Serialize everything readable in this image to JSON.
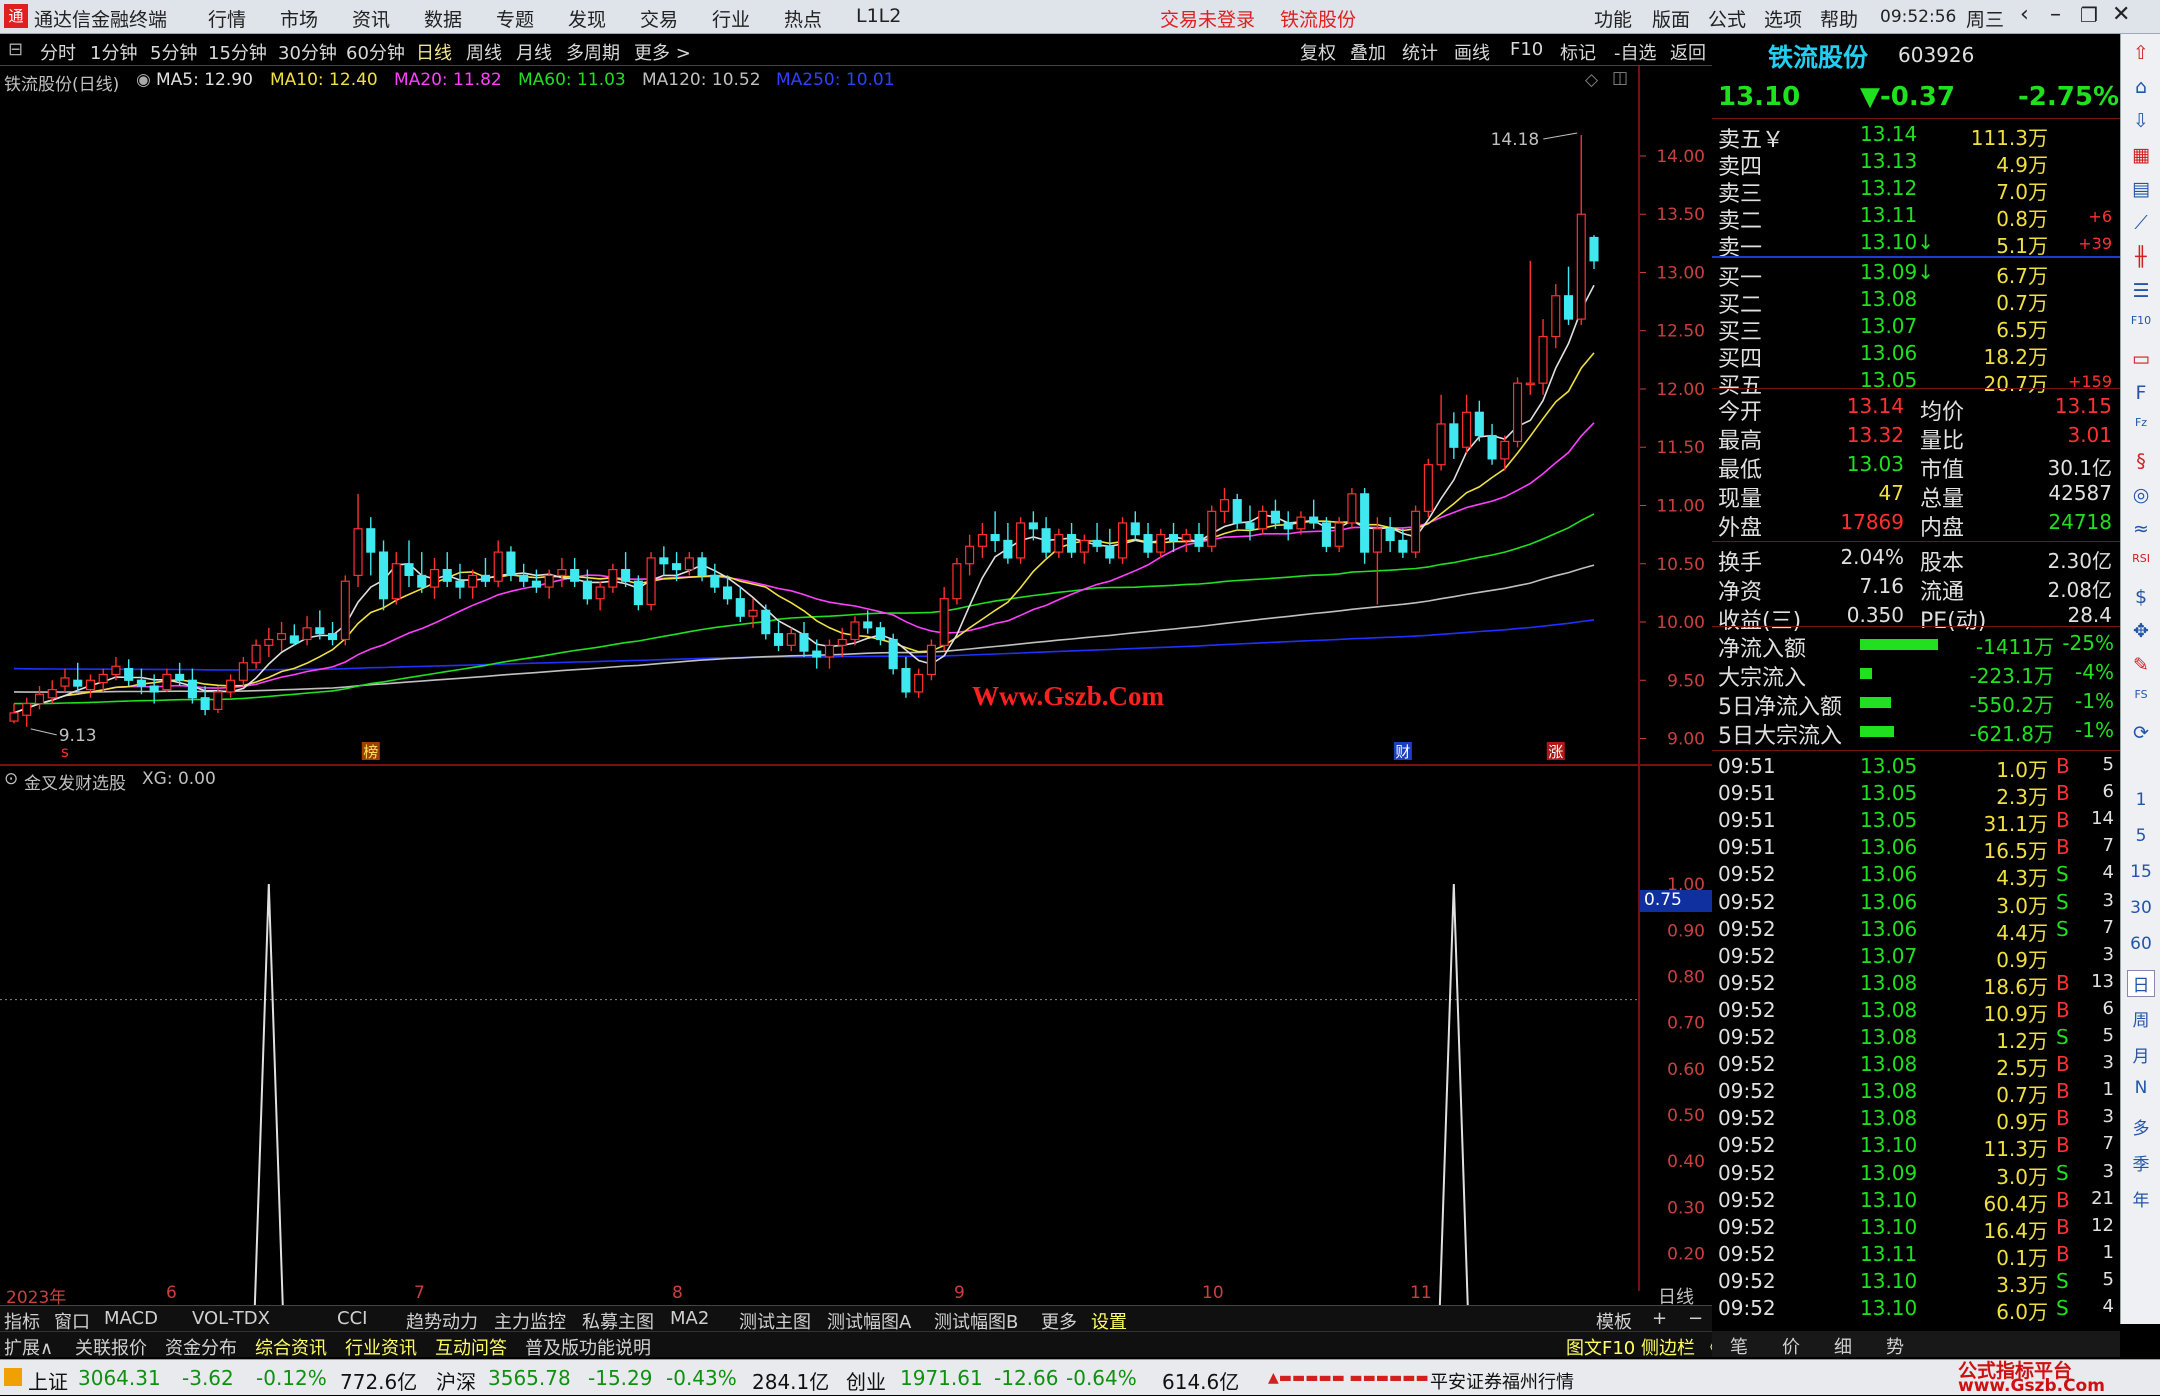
{
  "titlebar": {
    "app_title": "通达信金融终端",
    "menus": [
      "行情",
      "市场",
      "资讯",
      "数据",
      "专题",
      "发现",
      "交易",
      "行业",
      "热点",
      "L1L2"
    ],
    "status": "交易未登录",
    "stock": "铁流股份",
    "right_menus": [
      "功能",
      "版面",
      "公式",
      "选项",
      "帮助"
    ],
    "clock": "09:52:56",
    "weekday": "周三"
  },
  "toolbar": {
    "periods": [
      "分时",
      "1分钟",
      "5分钟",
      "15分钟",
      "30分钟",
      "60分钟",
      "日线",
      "周线",
      "月线",
      "多周期",
      "更多 >"
    ],
    "selected": "日线",
    "right": [
      "复权",
      "叠加",
      "统计",
      "画线",
      "F10",
      "标记",
      "-自选",
      "返回"
    ]
  },
  "chart_header": {
    "name": "铁流股份(日线)",
    "ma": [
      {
        "label": "MA5: 12.90",
        "color": "#e0e0e0"
      },
      {
        "label": "MA10: 12.40",
        "color": "#f0e040"
      },
      {
        "label": "MA20: 11.82",
        "color": "#ff40ff"
      },
      {
        "label": "MA60: 11.03",
        "color": "#20e020"
      },
      {
        "label": "MA120: 10.52",
        "color": "#c0c0c0"
      },
      {
        "label": "MA250: 10.01",
        "color": "#3040ff"
      }
    ]
  },
  "watermark": "Www.Gszb.Com",
  "high_label": "14.18",
  "low_label": "9.13",
  "markers": {
    "s": "s",
    "bang": "榜",
    "cai": "财",
    "zhang": "涨"
  },
  "indicator": {
    "name": "金叉发财选股",
    "value": "XG: 0.00",
    "cursor_value": "0.75"
  },
  "dates": {
    "start": "2023年",
    "m6": "6",
    "m7": "7",
    "m8": "8",
    "m9": "9",
    "m10": "10",
    "m11": "11",
    "period": "日线"
  },
  "chart_data": [
    {
      "type": "candlestick",
      "title": "铁流股份(日线)",
      "ylim": [
        8.85,
        14.3
      ],
      "yticks": [
        9.0,
        9.5,
        10.0,
        10.5,
        11.0,
        11.5,
        12.0,
        12.5,
        13.0,
        13.5,
        14.0
      ],
      "annotations": [
        "14.18",
        "9.13"
      ],
      "ohlc": [
        [
          9.15,
          9.3,
          9.13,
          9.22
        ],
        [
          9.2,
          9.35,
          9.1,
          9.3
        ],
        [
          9.3,
          9.45,
          9.25,
          9.38
        ],
        [
          9.35,
          9.5,
          9.3,
          9.42
        ],
        [
          9.45,
          9.6,
          9.4,
          9.52
        ],
        [
          9.5,
          9.65,
          9.4,
          9.45
        ],
        [
          9.42,
          9.55,
          9.35,
          9.5
        ],
        [
          9.48,
          9.6,
          9.4,
          9.55
        ],
        [
          9.55,
          9.7,
          9.5,
          9.62
        ],
        [
          9.6,
          9.68,
          9.45,
          9.5
        ],
        [
          9.5,
          9.6,
          9.38,
          9.45
        ],
        [
          9.45,
          9.55,
          9.3,
          9.4
        ],
        [
          9.42,
          9.6,
          9.4,
          9.55
        ],
        [
          9.55,
          9.65,
          9.45,
          9.5
        ],
        [
          9.5,
          9.6,
          9.3,
          9.35
        ],
        [
          9.35,
          9.45,
          9.2,
          9.25
        ],
        [
          9.25,
          9.45,
          9.22,
          9.4
        ],
        [
          9.4,
          9.55,
          9.35,
          9.5
        ],
        [
          9.5,
          9.7,
          9.45,
          9.65
        ],
        [
          9.65,
          9.85,
          9.6,
          9.8
        ],
        [
          9.8,
          9.95,
          9.7,
          9.85
        ],
        [
          9.85,
          10.0,
          9.75,
          9.9
        ],
        [
          9.88,
          9.98,
          9.8,
          9.82
        ],
        [
          9.85,
          10.05,
          9.8,
          9.95
        ],
        [
          9.95,
          10.1,
          9.85,
          9.9
        ],
        [
          9.9,
          10.0,
          9.8,
          9.85
        ],
        [
          9.85,
          10.4,
          9.8,
          10.35
        ],
        [
          10.4,
          11.1,
          10.3,
          10.8
        ],
        [
          10.8,
          10.9,
          10.4,
          10.6
        ],
        [
          10.6,
          10.7,
          10.1,
          10.2
        ],
        [
          10.2,
          10.6,
          10.15,
          10.5
        ],
        [
          10.5,
          10.7,
          10.3,
          10.4
        ],
        [
          10.4,
          10.6,
          10.25,
          10.3
        ],
        [
          10.3,
          10.55,
          10.2,
          10.45
        ],
        [
          10.45,
          10.6,
          10.3,
          10.35
        ],
        [
          10.35,
          10.5,
          10.2,
          10.3
        ],
        [
          10.3,
          10.45,
          10.2,
          10.4
        ],
        [
          10.4,
          10.55,
          10.3,
          10.35
        ],
        [
          10.35,
          10.7,
          10.3,
          10.6
        ],
        [
          10.6,
          10.65,
          10.35,
          10.4
        ],
        [
          10.4,
          10.5,
          10.3,
          10.35
        ],
        [
          10.35,
          10.45,
          10.25,
          10.3
        ],
        [
          10.3,
          10.45,
          10.2,
          10.4
        ],
        [
          10.4,
          10.55,
          10.3,
          10.45
        ],
        [
          10.45,
          10.55,
          10.3,
          10.35
        ],
        [
          10.35,
          10.45,
          10.15,
          10.2
        ],
        [
          10.2,
          10.35,
          10.1,
          10.3
        ],
        [
          10.3,
          10.5,
          10.25,
          10.45
        ],
        [
          10.45,
          10.6,
          10.3,
          10.35
        ],
        [
          10.35,
          10.4,
          10.1,
          10.15
        ],
        [
          10.15,
          10.6,
          10.1,
          10.55
        ],
        [
          10.55,
          10.65,
          10.4,
          10.5
        ],
        [
          10.5,
          10.6,
          10.35,
          10.45
        ],
        [
          10.45,
          10.6,
          10.4,
          10.55
        ],
        [
          10.55,
          10.6,
          10.35,
          10.4
        ],
        [
          10.4,
          10.5,
          10.25,
          10.3
        ],
        [
          10.3,
          10.4,
          10.15,
          10.2
        ],
        [
          10.2,
          10.3,
          10.0,
          10.05
        ],
        [
          10.05,
          10.2,
          9.95,
          10.1
        ],
        [
          10.1,
          10.15,
          9.85,
          9.9
        ],
        [
          9.9,
          10.0,
          9.75,
          9.8
        ],
        [
          9.8,
          9.95,
          9.75,
          9.9
        ],
        [
          9.9,
          10.0,
          9.7,
          9.75
        ],
        [
          9.75,
          9.85,
          9.6,
          9.7
        ],
        [
          9.7,
          9.85,
          9.6,
          9.8
        ],
        [
          9.8,
          9.95,
          9.7,
          9.85
        ],
        [
          9.85,
          10.05,
          9.8,
          10.0
        ],
        [
          10.0,
          10.1,
          9.9,
          9.95
        ],
        [
          9.95,
          10.0,
          9.8,
          9.85
        ],
        [
          9.85,
          9.9,
          9.55,
          9.6
        ],
        [
          9.6,
          9.7,
          9.35,
          9.4
        ],
        [
          9.4,
          9.6,
          9.35,
          9.55
        ],
        [
          9.55,
          9.85,
          9.5,
          9.8
        ],
        [
          9.8,
          10.3,
          9.75,
          10.2
        ],
        [
          10.2,
          10.55,
          10.15,
          10.5
        ],
        [
          10.5,
          10.75,
          10.4,
          10.65
        ],
        [
          10.65,
          10.85,
          10.55,
          10.75
        ],
        [
          10.75,
          10.95,
          10.6,
          10.7
        ],
        [
          10.7,
          10.85,
          10.5,
          10.55
        ],
        [
          10.55,
          10.9,
          10.5,
          10.85
        ],
        [
          10.85,
          10.95,
          10.7,
          10.8
        ],
        [
          10.8,
          10.9,
          10.55,
          10.6
        ],
        [
          10.6,
          10.8,
          10.55,
          10.75
        ],
        [
          10.75,
          10.85,
          10.55,
          10.6
        ],
        [
          10.6,
          10.75,
          10.5,
          10.7
        ],
        [
          10.7,
          10.85,
          10.6,
          10.65
        ],
        [
          10.65,
          10.8,
          10.5,
          10.55
        ],
        [
          10.55,
          10.9,
          10.5,
          10.85
        ],
        [
          10.85,
          10.95,
          10.7,
          10.75
        ],
        [
          10.75,
          10.85,
          10.55,
          10.6
        ],
        [
          10.6,
          10.8,
          10.55,
          10.75
        ],
        [
          10.75,
          10.85,
          10.6,
          10.7
        ],
        [
          10.7,
          10.8,
          10.6,
          10.75
        ],
        [
          10.75,
          10.85,
          10.6,
          10.65
        ],
        [
          10.65,
          11.0,
          10.6,
          10.95
        ],
        [
          10.95,
          11.15,
          10.85,
          11.05
        ],
        [
          11.05,
          11.1,
          10.8,
          10.85
        ],
        [
          10.85,
          11.0,
          10.7,
          10.8
        ],
        [
          10.8,
          11.0,
          10.75,
          10.95
        ],
        [
          10.95,
          11.05,
          10.8,
          10.85
        ],
        [
          10.85,
          10.95,
          10.7,
          10.8
        ],
        [
          10.8,
          10.95,
          10.75,
          10.9
        ],
        [
          10.9,
          11.05,
          10.8,
          10.85
        ],
        [
          10.85,
          10.9,
          10.6,
          10.65
        ],
        [
          10.65,
          10.9,
          10.6,
          10.85
        ],
        [
          10.85,
          11.15,
          10.8,
          11.1
        ],
        [
          11.1,
          11.15,
          10.5,
          10.6
        ],
        [
          10.6,
          10.9,
          10.15,
          10.8
        ],
        [
          10.8,
          10.9,
          10.6,
          10.7
        ],
        [
          10.7,
          10.8,
          10.55,
          10.6
        ],
        [
          10.6,
          11.0,
          10.55,
          10.95
        ],
        [
          10.95,
          11.4,
          10.9,
          11.35
        ],
        [
          11.35,
          11.95,
          11.3,
          11.7
        ],
        [
          11.7,
          11.8,
          11.4,
          11.5
        ],
        [
          11.5,
          11.95,
          11.45,
          11.8
        ],
        [
          11.8,
          11.9,
          11.55,
          11.6
        ],
        [
          11.6,
          11.7,
          11.35,
          11.4
        ],
        [
          11.4,
          11.6,
          11.3,
          11.55
        ],
        [
          11.55,
          12.1,
          11.5,
          12.05
        ],
        [
          12.05,
          13.1,
          11.95,
          12.05
        ],
        [
          12.05,
          12.6,
          11.95,
          12.45
        ],
        [
          12.45,
          12.9,
          12.35,
          12.8
        ],
        [
          12.8,
          13.05,
          12.55,
          12.6
        ],
        [
          12.6,
          14.18,
          12.55,
          13.5
        ],
        [
          13.3,
          13.32,
          13.03,
          13.1
        ]
      ],
      "series": [
        {
          "name": "MA5",
          "values": [
            12.9
          ]
        },
        {
          "name": "MA10",
          "values": [
            12.4
          ]
        },
        {
          "name": "MA20",
          "values": [
            11.82
          ]
        },
        {
          "name": "MA60",
          "values": [
            11.03
          ]
        },
        {
          "name": "MA120",
          "values": [
            10.52
          ]
        },
        {
          "name": "MA250",
          "values": [
            10.01
          ]
        }
      ]
    },
    {
      "type": "line",
      "title": "金叉发财选股",
      "ylim": [
        0,
        1.05
      ],
      "yticks": [
        0.2,
        0.3,
        0.4,
        0.5,
        0.6,
        0.7,
        0.75,
        0.8,
        0.9,
        1.0
      ],
      "series": [
        {
          "name": "XG",
          "spikes_at_index": [
            20,
            113
          ],
          "values_note": "0 everywhere except two spikes to 1.00"
        }
      ]
    }
  ],
  "rpanel": {
    "name": "铁流股份",
    "code": "603926",
    "price": "13.10",
    "change": "▼-0.37",
    "pct": "-2.75%",
    "asks": [
      {
        "l": "卖五￥",
        "p": "13.14",
        "v": "111.3万",
        "d": ""
      },
      {
        "l": "卖四",
        "p": "13.13",
        "v": "4.9万",
        "d": ""
      },
      {
        "l": "卖三",
        "p": "13.12",
        "v": "7.0万",
        "d": ""
      },
      {
        "l": "卖二",
        "p": "13.11",
        "v": "0.8万",
        "d": "+6"
      },
      {
        "l": "卖一",
        "p": "13.10↓",
        "v": "5.1万",
        "d": "+39"
      }
    ],
    "bids": [
      {
        "l": "买一",
        "p": "13.09↓",
        "v": "6.7万",
        "d": ""
      },
      {
        "l": "买二",
        "p": "13.08",
        "v": "0.7万",
        "d": ""
      },
      {
        "l": "买三",
        "p": "13.07",
        "v": "6.5万",
        "d": ""
      },
      {
        "l": "买四",
        "p": "13.06",
        "v": "18.2万",
        "d": ""
      },
      {
        "l": "买五",
        "p": "13.05",
        "v": "20.7万",
        "d": "+159"
      }
    ],
    "stats": [
      {
        "a": "今开",
        "b": "13.14",
        "c": "均价",
        "d": "13.15"
      },
      {
        "a": "最高",
        "b": "13.32",
        "c": "量比",
        "d": "3.01"
      },
      {
        "a": "最低",
        "b": "13.03",
        "c": "市值",
        "d": "30.1亿"
      },
      {
        "a": "现量",
        "b": "47",
        "c": "总量",
        "d": "42587"
      },
      {
        "a": "外盘",
        "b": "17869",
        "c": "内盘",
        "d": "24718"
      }
    ],
    "stats2": [
      {
        "a": "换手",
        "b": "2.04%",
        "c": "股本",
        "d": "2.30亿"
      },
      {
        "a": "净资",
        "b": "7.16",
        "c": "流通",
        "d": "2.08亿"
      },
      {
        "a": "收益(三)",
        "b": "0.350",
        "c": "PE(动)",
        "d": "28.4"
      }
    ],
    "flows": [
      {
        "a": "净流入额",
        "v": "-1411万",
        "p": "-25%",
        "bar": 0.75
      },
      {
        "a": "大宗流入",
        "v": "-223.1万",
        "p": "-4%",
        "bar": 0.12
      },
      {
        "a": "5日净流入额",
        "v": "-550.2万",
        "p": "-1%",
        "bar": 0.3
      },
      {
        "a": "5日大宗流入",
        "v": "-621.8万",
        "p": "-1%",
        "bar": 0.33
      }
    ],
    "ticks": [
      [
        "09:51",
        "13.05",
        "1.0万",
        "B",
        "5"
      ],
      [
        "09:51",
        "13.05",
        "2.3万",
        "B",
        "6"
      ],
      [
        "09:51",
        "13.05",
        "31.1万",
        "B",
        "14"
      ],
      [
        "09:51",
        "13.06",
        "16.5万",
        "B",
        "7"
      ],
      [
        "09:52",
        "13.06",
        "4.3万",
        "S",
        "4"
      ],
      [
        "09:52",
        "13.06",
        "3.0万",
        "S",
        "3"
      ],
      [
        "09:52",
        "13.06",
        "4.4万",
        "S",
        "7"
      ],
      [
        "09:52",
        "13.07",
        "0.9万",
        "",
        "3"
      ],
      [
        "09:52",
        "13.08",
        "18.6万",
        "B",
        "13"
      ],
      [
        "09:52",
        "13.08",
        "10.9万",
        "B",
        "6"
      ],
      [
        "09:52",
        "13.08",
        "1.2万",
        "S",
        "5"
      ],
      [
        "09:52",
        "13.08",
        "2.5万",
        "B",
        "3"
      ],
      [
        "09:52",
        "13.08",
        "0.7万",
        "B",
        "1"
      ],
      [
        "09:52",
        "13.08",
        "0.9万",
        "B",
        "3"
      ],
      [
        "09:52",
        "13.10",
        "11.3万",
        "B",
        "7"
      ],
      [
        "09:52",
        "13.09",
        "3.0万",
        "S",
        "3"
      ],
      [
        "09:52",
        "13.10",
        "60.4万",
        "B",
        "21"
      ],
      [
        "09:52",
        "13.10",
        "16.4万",
        "B",
        "12"
      ],
      [
        "09:52",
        "13.11",
        "0.1万",
        "B",
        "1"
      ],
      [
        "09:52",
        "13.10",
        "3.3万",
        "S",
        "5"
      ],
      [
        "09:52",
        "13.10",
        "6.0万",
        "S",
        "4"
      ]
    ],
    "tabs": [
      "笔",
      "价",
      "细",
      "势"
    ]
  },
  "tabs1": [
    "指标",
    "窗口",
    "MACD",
    "VOL-TDX",
    "CCI",
    "趋势动力",
    "主力监控",
    "私募主图",
    "MA2",
    "测试主图",
    "测试幅图A",
    "测试幅图B",
    "更多",
    "设置"
  ],
  "tabs1_right": [
    "模板",
    "+",
    "−"
  ],
  "tabs2": [
    "扩展∧",
    "关联报价",
    "资金分布",
    "综合资讯",
    "行业资讯",
    "互动问答",
    "普及版功能说明"
  ],
  "tabs2_right": "图文F10 侧边栏 《",
  "statusbar": {
    "sh_label": "上证",
    "sh": "3064.31",
    "sh_chg": "-3.62",
    "sh_pct": "-0.12%",
    "sh_amt": "772.6亿",
    "hs_label": "沪深",
    "hs": "3565.78",
    "hs_chg": "-15.29",
    "hs_pct": "-0.43%",
    "hs_amt": "284.1亿",
    "cy_label": "创业",
    "cy": "1971.61",
    "cy_chg": "-12.66",
    "cy_pct": "-0.64%",
    "cy_amt": "614.6亿",
    "broker": "平安证券福州行情",
    "logo1": "公式指标平台",
    "logo2": "www.Gszb.Com"
  },
  "sidebar": {
    "labels": [
      "1",
      "5",
      "15",
      "30",
      "60",
      "日",
      "周",
      "月",
      "N",
      "多",
      "季",
      "年"
    ]
  }
}
